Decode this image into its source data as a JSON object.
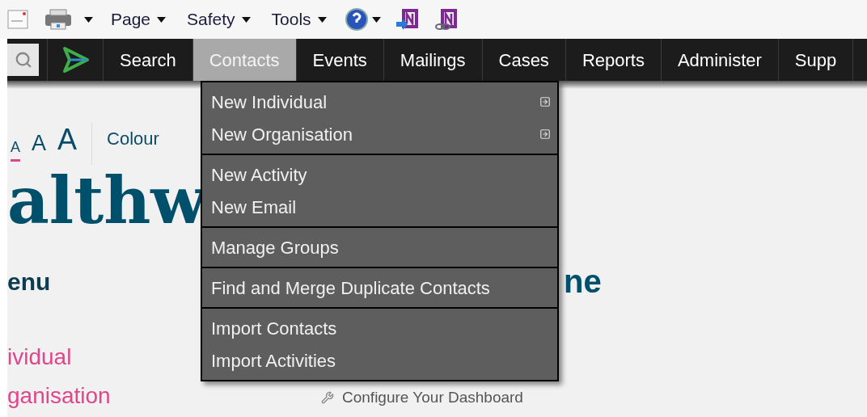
{
  "browser_toolbar": {
    "menus": [
      {
        "label": "Page"
      },
      {
        "label": "Safety"
      },
      {
        "label": "Tools"
      }
    ]
  },
  "nav": {
    "items": [
      {
        "label": "Search",
        "selected": false
      },
      {
        "label": "Contacts",
        "selected": true
      },
      {
        "label": "Events",
        "selected": false
      },
      {
        "label": "Mailings",
        "selected": false
      },
      {
        "label": "Cases",
        "selected": false
      },
      {
        "label": "Reports",
        "selected": false
      },
      {
        "label": "Administer",
        "selected": false
      },
      {
        "label": "Supp",
        "selected": false
      }
    ]
  },
  "dropdown": {
    "groups": [
      {
        "items": [
          {
            "label": "New Individual",
            "submenu": true
          },
          {
            "label": "New Organisation",
            "submenu": true
          }
        ]
      },
      {
        "items": [
          {
            "label": "New Activity",
            "submenu": false
          },
          {
            "label": "New Email",
            "submenu": false
          }
        ]
      },
      {
        "items": [
          {
            "label": "Manage Groups",
            "submenu": false
          }
        ]
      },
      {
        "items": [
          {
            "label": "Find and Merge Duplicate Contacts",
            "submenu": false
          }
        ]
      },
      {
        "items": [
          {
            "label": "Import Contacts",
            "submenu": false
          },
          {
            "label": "Import Activities",
            "submenu": false
          }
        ]
      }
    ]
  },
  "page": {
    "font_size_controls": [
      {
        "label": "A",
        "selected": true
      },
      {
        "label": "A",
        "selected": false
      },
      {
        "label": "A",
        "selected": false
      }
    ],
    "colour_label": "Colour",
    "heading": "althw",
    "menu_title": "enu",
    "menu_links": [
      "ividual",
      "ganisation"
    ],
    "dashboard_heading": "ne",
    "dashboard_link": "Configure Your Dashboard"
  }
}
